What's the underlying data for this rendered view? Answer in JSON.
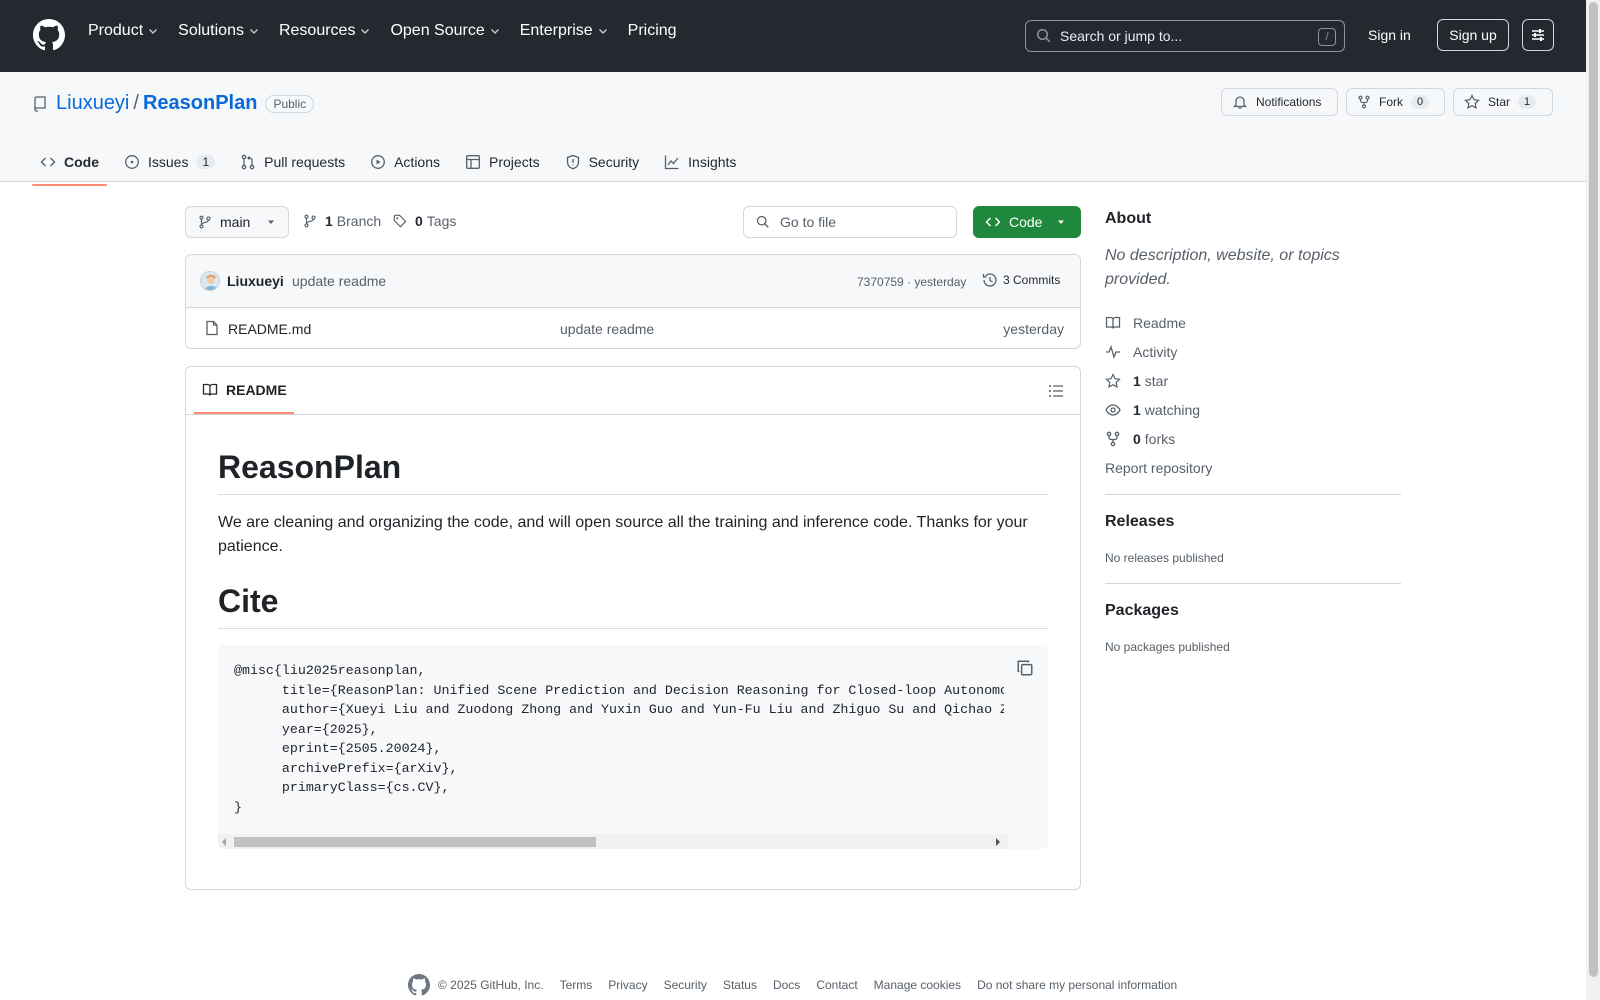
{
  "header": {
    "nav": [
      "Product",
      "Solutions",
      "Resources",
      "Open Source",
      "Enterprise",
      "Pricing"
    ],
    "search_placeholder": "Search or jump to...",
    "search_shortcut": "/",
    "signin": "Sign in",
    "signup": "Sign up"
  },
  "repo": {
    "owner": "Liuxueyi",
    "separator": "/",
    "name": "ReasonPlan",
    "visibility": "Public",
    "notifications": "Notifications",
    "fork_label": "Fork",
    "fork_count": "0",
    "star_label": "Star",
    "star_count": "1"
  },
  "tabs": [
    {
      "label": "Code",
      "count": ""
    },
    {
      "label": "Issues",
      "count": "1"
    },
    {
      "label": "Pull requests",
      "count": ""
    },
    {
      "label": "Actions",
      "count": ""
    },
    {
      "label": "Projects",
      "count": ""
    },
    {
      "label": "Security",
      "count": ""
    },
    {
      "label": "Insights",
      "count": ""
    }
  ],
  "toolbar": {
    "branch": "main",
    "branch_count": "1",
    "branch_label": "Branch",
    "tag_count": "0",
    "tag_label": "Tags",
    "goto_file": "Go to file",
    "code_button": "Code"
  },
  "commit": {
    "author": "Liuxueyi",
    "message": "update readme",
    "hash_time": "7370759 · yesterday",
    "commits_label": "3 Commits"
  },
  "files": [
    {
      "name": "README.md",
      "message": "update readme",
      "date": "yesterday"
    }
  ],
  "readme": {
    "tab_label": "README",
    "title": "ReasonPlan",
    "paragraph": "We are cleaning and organizing the code, and will open source all the training and inference code. Thanks for your patience.",
    "cite_heading": "Cite",
    "code": "@misc{liu2025reasonplan,\n      title={ReasonPlan: Unified Scene Prediction and Decision Reasoning for Closed-loop Autonomous Driving},\n      author={Xueyi Liu and Zuodong Zhong and Yuxin Guo and Yun-Fu Liu and Zhiguo Su and Qichao Zhang},\n      year={2025},\n      eprint={2505.20024},\n      archivePrefix={arXiv},\n      primaryClass={cs.CV},\n}"
  },
  "about": {
    "heading": "About",
    "description": "No description, website, or topics provided.",
    "readme": "Readme",
    "activity": "Activity",
    "stars_count": "1",
    "stars_label": "star",
    "watching_count": "1",
    "watching_label": "watching",
    "forks_count": "0",
    "forks_label": "forks",
    "report": "Report repository"
  },
  "releases": {
    "heading": "Releases",
    "text": "No releases published"
  },
  "packages": {
    "heading": "Packages",
    "text": "No packages published"
  },
  "footer": {
    "copyright": "© 2025 GitHub, Inc.",
    "links": [
      "Terms",
      "Privacy",
      "Security",
      "Status",
      "Docs",
      "Contact",
      "Manage cookies",
      "Do not share my personal information"
    ]
  },
  "colors": {
    "header_bg": "#24292f",
    "link": "#0969da",
    "green": "#1f883d",
    "tab_underline": "#fd8c73"
  }
}
